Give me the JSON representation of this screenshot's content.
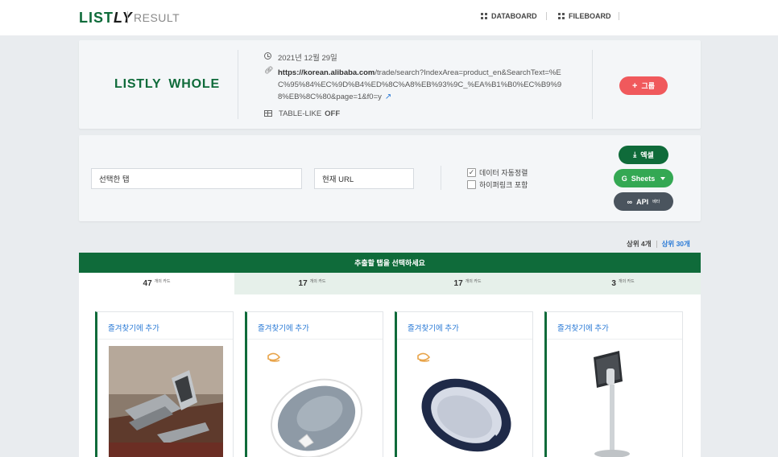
{
  "header": {
    "logo_main": "LIST",
    "logo_ly": "LY",
    "logo_sub": "RESULT",
    "nav": [
      {
        "label": "DATABOARD"
      },
      {
        "label": "FILEBOARD"
      }
    ]
  },
  "info": {
    "brand": "LISTLY WHOLE",
    "date": "2021년 12월 29일",
    "url_bold": "https://korean.alibaba.com",
    "url_rest": "/trade/search?IndexArea=product_en&SearchText=%EC%95%84%EC%9D%B4%ED%8C%A8%EB%93%9C_%EA%B1%B0%EC%B9%98%EB%8C%80&page=1&f0=y",
    "table_like_label": "TABLE-LIKE",
    "table_like_value": "OFF",
    "group_button": "그룹"
  },
  "controls": {
    "selected_tab_value": "선택한 탭",
    "current_url_value": "현재 URL",
    "auto_sort_label": "데이터 자동정렬",
    "auto_sort_checked": true,
    "include_hyperlink_label": "하이퍼링크 포함",
    "include_hyperlink_checked": false,
    "excel_button": "엑셀",
    "sheets_button": "Sheets",
    "api_button": "API",
    "api_badge": "베타"
  },
  "tops": {
    "top4": "상위 4개",
    "top30": "상위 30개"
  },
  "banner": "추출할 탭을 선택하세요",
  "tabs": [
    {
      "count": "47",
      "unit": "개의 카드",
      "active": true
    },
    {
      "count": "17",
      "unit": "개의 카드",
      "active": false
    },
    {
      "count": "17",
      "unit": "개의 카드",
      "active": false
    },
    {
      "count": "3",
      "unit": "개의 카드",
      "active": false
    }
  ],
  "cards": [
    {
      "fav_label": "즐겨찾기에 추가",
      "image": "tablet-stand-foldable"
    },
    {
      "fav_label": "즐겨찾기에 추가",
      "image": "baby-nest-grey"
    },
    {
      "fav_label": "즐겨찾기에 추가",
      "image": "baby-nest-navy"
    },
    {
      "fav_label": "즐겨찾기에 추가",
      "image": "tablet-floor-stand"
    }
  ],
  "colors": {
    "brand_green": "#0f6b3a",
    "accent_red": "#f0595c",
    "sheets_green": "#34a853",
    "api_grey": "#4a545e",
    "link_blue": "#2a7ad6"
  }
}
